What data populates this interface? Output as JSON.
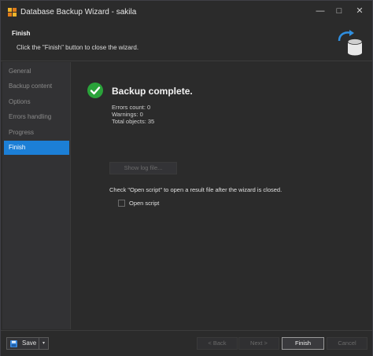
{
  "window": {
    "title": "Database Backup Wizard - sakila",
    "minimize_glyph": "—",
    "maximize_glyph": "□",
    "close_glyph": "✕"
  },
  "header": {
    "title": "Finish",
    "description": "Click the \"Finish\" button to close the wizard."
  },
  "sidebar": {
    "items": [
      {
        "label": "General"
      },
      {
        "label": "Backup content"
      },
      {
        "label": "Options"
      },
      {
        "label": "Errors handling"
      },
      {
        "label": "Progress"
      },
      {
        "label": "Finish",
        "active": true
      }
    ]
  },
  "main": {
    "status_title": "Backup complete.",
    "errors_count": "Errors count: 0",
    "warnings": "Warnings: 0",
    "total_objects": "Total objects: 35",
    "show_log_label": "Show log file...",
    "open_script_hint": "Check \"Open script\" to open a result file after the wizard is closed.",
    "open_script_label": "Open script",
    "open_script_checked": false
  },
  "footer": {
    "save_label": "Save",
    "save_dropdown_glyph": "▾",
    "back_label": "< Back",
    "next_label": "Next >",
    "finish_label": "Finish",
    "cancel_label": "Cancel"
  },
  "colors": {
    "accent": "#1c7fd6",
    "success": "#2aa33a",
    "background": "#2b2b2b"
  },
  "icons": {
    "app": "database-wizard-icon",
    "header": "database-backup-icon",
    "status": "check-circle-icon",
    "save": "floppy-disk-icon"
  }
}
